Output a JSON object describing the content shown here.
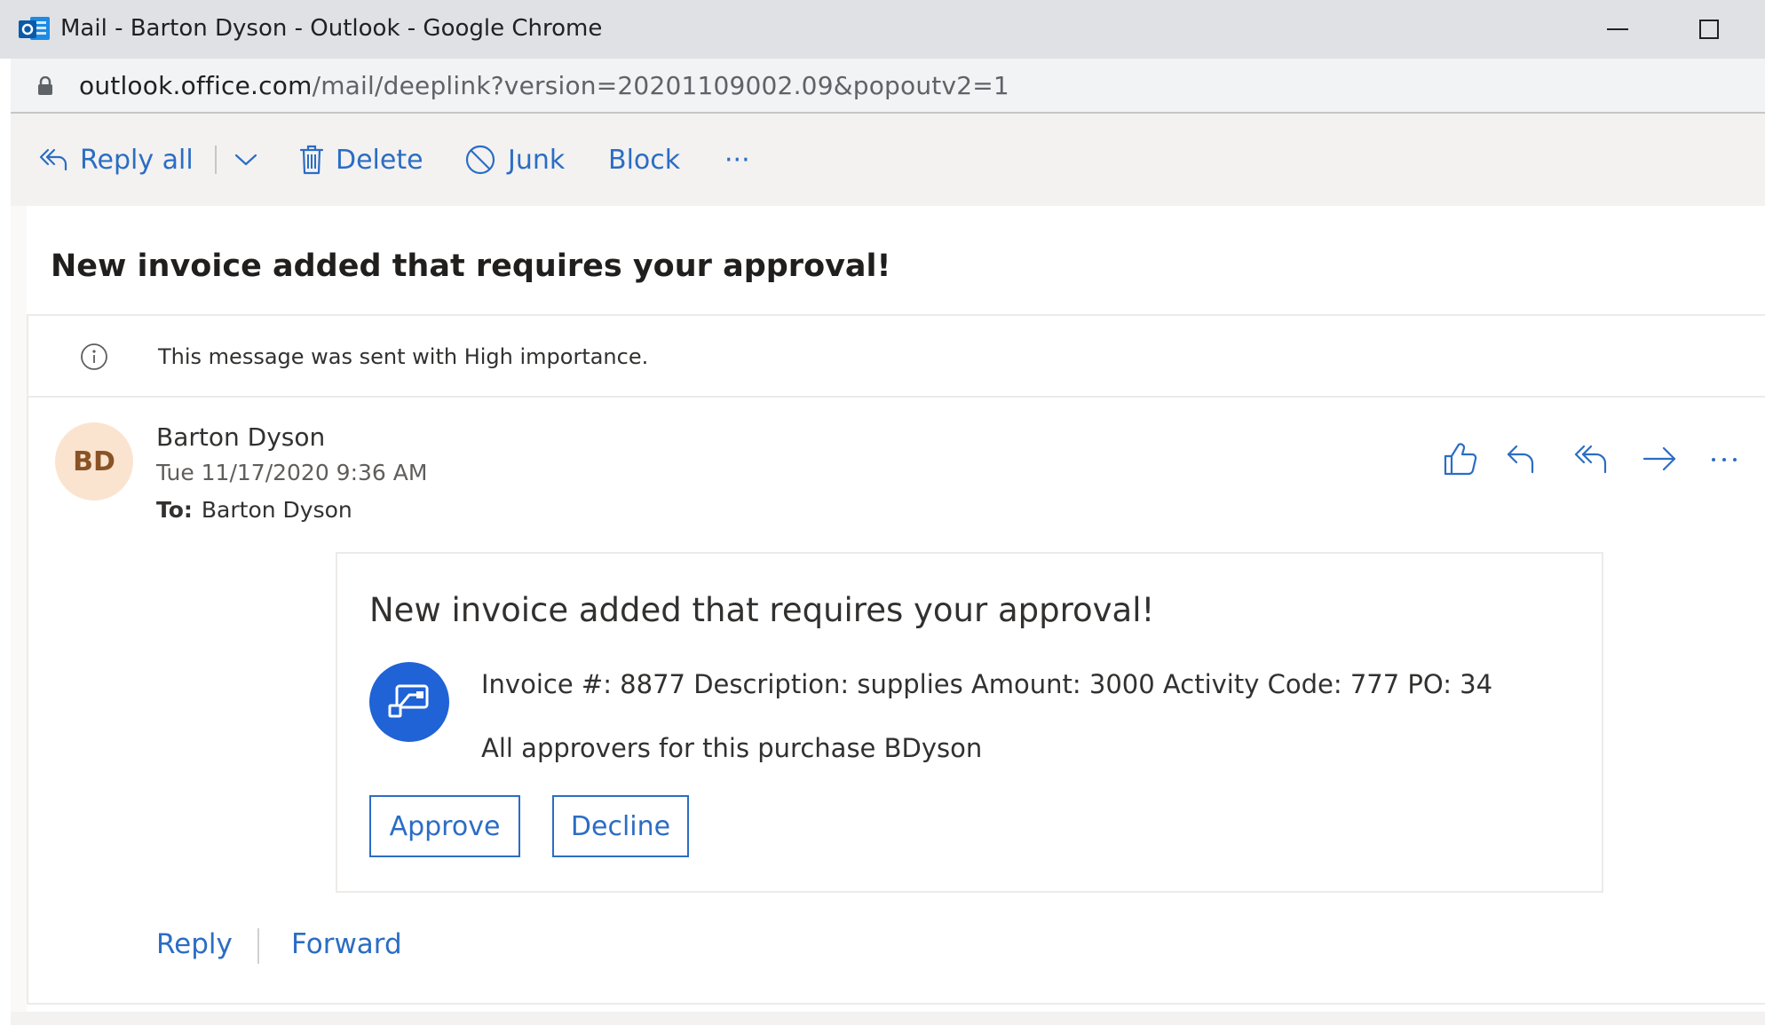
{
  "window": {
    "title": "Mail - Barton Dyson - Outlook - Google Chrome"
  },
  "address_bar": {
    "host": "outlook.office.com",
    "path": "/mail/deeplink?version=20201109002.09&popoutv2=1"
  },
  "toolbar": {
    "reply_all": "Reply all",
    "delete": "Delete",
    "junk": "Junk",
    "block": "Block",
    "more": "···"
  },
  "email": {
    "subject": "New invoice added that requires your approval!",
    "importance_notice": "This message was sent with High importance.",
    "sender": {
      "initials": "BD",
      "name": "Barton Dyson"
    },
    "date": "Tue 11/17/2020 9:36 AM",
    "to_label": "To:",
    "to_value": "Barton Dyson",
    "card": {
      "title": "New invoice added that requires your approval!",
      "line1": "Invoice #: 8877 Description: supplies Amount: 3000 Activity Code: 777 PO: 34",
      "line2": "All approvers for this purchase BDyson",
      "approve": "Approve",
      "decline": "Decline"
    },
    "footer": {
      "reply": "Reply",
      "forward": "Forward"
    }
  },
  "colors": {
    "accent": "#2b6dc4",
    "avatar_bg": "#fbe4cf",
    "avatar_text": "#8a5326",
    "flow_icon_bg": "#1f63d6"
  }
}
